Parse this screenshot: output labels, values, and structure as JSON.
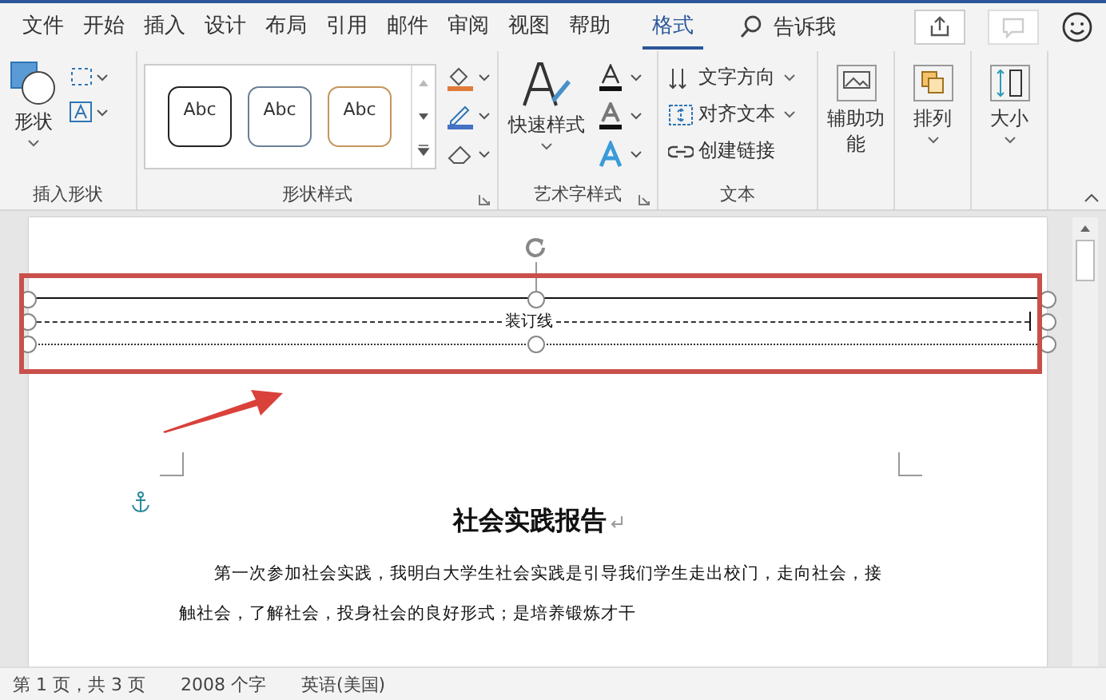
{
  "tabs": [
    {
      "label": "文件",
      "selected": false
    },
    {
      "label": "开始",
      "selected": false
    },
    {
      "label": "插入",
      "selected": false
    },
    {
      "label": "设计",
      "selected": false
    },
    {
      "label": "布局",
      "selected": false
    },
    {
      "label": "引用",
      "selected": false
    },
    {
      "label": "邮件",
      "selected": false
    },
    {
      "label": "审阅",
      "selected": false
    },
    {
      "label": "视图",
      "selected": false
    },
    {
      "label": "帮助",
      "selected": false
    },
    {
      "label": "格式",
      "selected": true
    }
  ],
  "tell_me": {
    "placeholder": "告诉我"
  },
  "comments_button": {
    "disabled": true
  },
  "ribbon": {
    "insert_shapes": {
      "label": "插入形状",
      "shapes_button": "形状"
    },
    "shape_styles": {
      "label": "形状样式",
      "styles": [
        {
          "text": "Abc",
          "color": "#222222"
        },
        {
          "text": "Abc",
          "color": "#6a7f95"
        },
        {
          "text": "Abc",
          "color": "#c4955a"
        }
      ]
    },
    "wordart_styles": {
      "label": "艺术字样式",
      "quick_styles": "快速样式"
    },
    "text": {
      "label": "文本",
      "items": [
        "文字方向",
        "对齐文本",
        "创建链接"
      ]
    },
    "accessibility": "辅助功能",
    "arrange": "排列",
    "size": "大小"
  },
  "document": {
    "header_text": "装订线",
    "title": "社会实践报告",
    "paragraph_lines": [
      "第一次参加社会实践，我明白大学生社会实践是引导我们学生走出校门，走向社会，接",
      "触社会，了解社会，投身社会的良好形式；是培养锻炼才干"
    ]
  },
  "status_bar": {
    "page": "第 1 页，共 3 页",
    "words": "2008 个字",
    "language": "英语(美国)"
  }
}
